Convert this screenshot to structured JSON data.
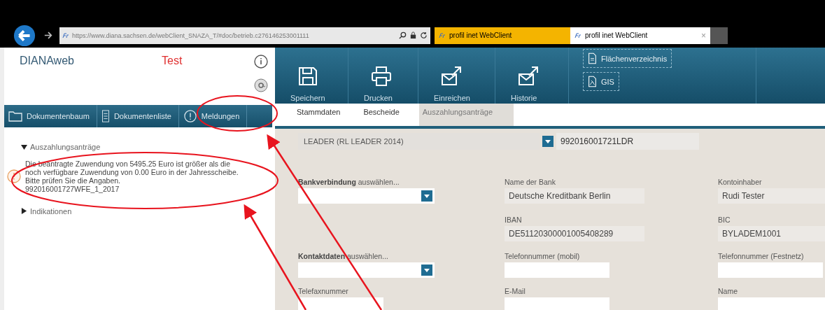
{
  "browser": {
    "url": "https://www.diana.sachsen.de/webClient_SNAZA_T/#doc/betrieb.c276146253001111",
    "tabs": [
      {
        "title": "profil inet WebClient",
        "selected": false
      },
      {
        "title": "profil inet WebClient",
        "selected": true,
        "close": "×"
      }
    ]
  },
  "app": {
    "name": "DIANAweb",
    "environment": "Test"
  },
  "nav": [
    {
      "label": "Dokumentenbaum",
      "kind": "folder"
    },
    {
      "label": "Dokumentenliste",
      "kind": "list"
    },
    {
      "label": "Meldungen",
      "kind": "info"
    }
  ],
  "tree": [
    {
      "label": "Auszahlungsanträge",
      "expanded": true,
      "children": [
        {
          "kind": "warning",
          "text": "Die beantragte Zuwendung von 5495.25 Euro ist größer als die noch verfügbare Zuwendung von 0.00 Euro in der Jahresscheibe. Bitte prüfen Sie die Angaben.",
          "reference": "992016001727WFE_1_2017"
        }
      ]
    },
    {
      "label": "Indikationen",
      "expanded": false
    }
  ],
  "toolbar": [
    {
      "label": "Speichern",
      "kind": "save"
    },
    {
      "label": "Drucken",
      "kind": "print"
    },
    {
      "label": "Einreichen",
      "kind": "send"
    },
    {
      "label": "Historie",
      "kind": "send"
    }
  ],
  "toolbar_small": [
    {
      "label": "Flächenverzeichnis",
      "kind": "document"
    },
    {
      "label": "GIS",
      "kind": "map"
    }
  ],
  "tabs": [
    {
      "label": "Stammdaten",
      "selected": false
    },
    {
      "label": "Bescheide",
      "selected": false
    },
    {
      "label": "Auszahlungsanträge",
      "selected": true
    }
  ],
  "program": {
    "name": "LEADER (RL LEADER 2014)",
    "number": "992016001721LDR"
  },
  "form": [
    [
      {
        "kind": "select",
        "label": "**Bankverbindung** auswählen..."
      },
      {
        "kind": "readonly",
        "label": "Name der Bank",
        "value": "Deutsche Kreditbank Berlin"
      },
      {
        "kind": "readonly",
        "label": "Kontoinhaber",
        "value": "Rudi Tester"
      }
    ],
    [
      {
        "kind": "empty"
      },
      {
        "kind": "readonly",
        "label": "IBAN",
        "value": "DE51120300001005408289"
      },
      {
        "kind": "readonly",
        "label": "BIC",
        "value": "BYLADEM1001"
      }
    ],
    [
      {
        "kind": "select",
        "label": "**Kontaktdaten** auswählen..."
      },
      {
        "kind": "text",
        "label": "Telefonnummer (mobil)"
      },
      {
        "kind": "text",
        "label": "Telefonnummer (Festnetz)"
      }
    ],
    [
      {
        "kind": "short",
        "label": "Telefaxnummer"
      },
      {
        "kind": "text",
        "label": "E-Mail"
      },
      {
        "kind": "wide",
        "label": "Name"
      }
    ]
  ]
}
